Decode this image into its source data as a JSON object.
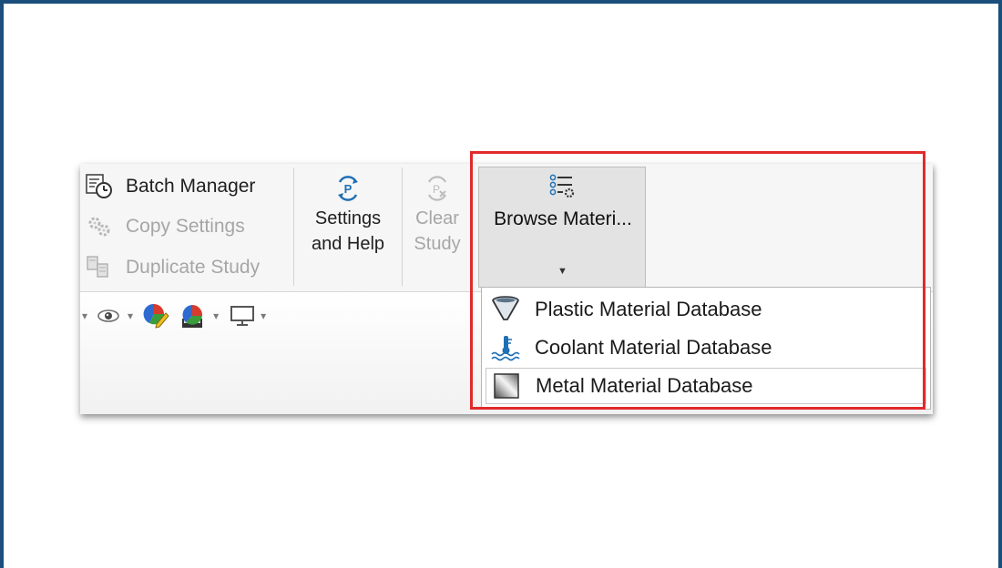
{
  "left_group": {
    "batch_manager": "Batch Manager",
    "copy_settings": "Copy Settings",
    "duplicate_study": "Duplicate Study"
  },
  "settings_help": {
    "line1": "Settings",
    "line2": "and Help"
  },
  "clear_study": {
    "line1": "Clear",
    "line2": "Study"
  },
  "browse": {
    "label": "Browse Materi..."
  },
  "dropdown": {
    "items": [
      {
        "label": "Plastic Material Database",
        "icon": "funnel-icon"
      },
      {
        "label": "Coolant Material Database",
        "icon": "thermometer-water-icon"
      },
      {
        "label": "Metal Material Database",
        "icon": "metal-block-icon"
      }
    ]
  },
  "colors": {
    "frame": "#1a4f7c",
    "highlight": "#e12a2a",
    "accent_blue": "#1f6fb5"
  }
}
